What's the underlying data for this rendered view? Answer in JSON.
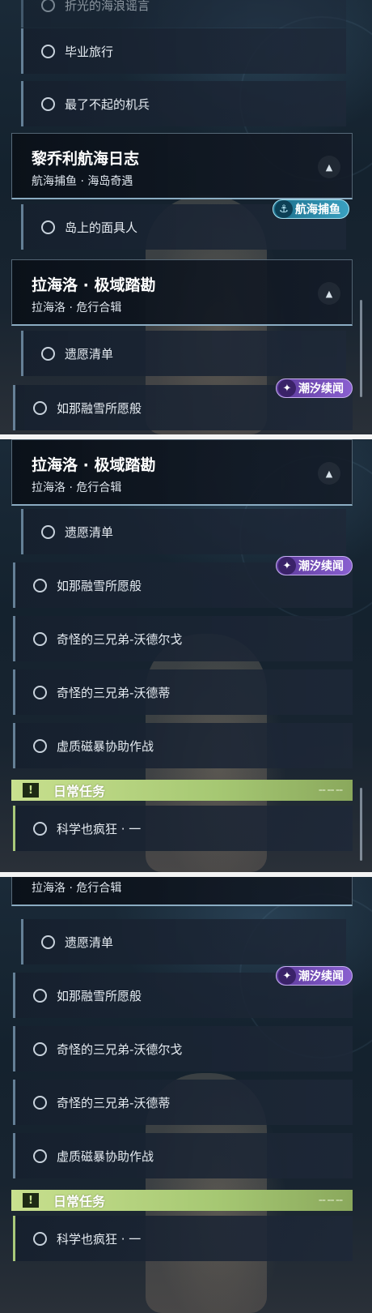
{
  "panel1": {
    "cut_item": "折光的海浪谣言",
    "items_top": [
      "毕业旅行",
      "最了不起的机兵"
    ],
    "header1": {
      "title": "黎乔利航海日志",
      "subtitle": "航海捕鱼 · 海岛奇遇"
    },
    "badge_fishing": "航海捕鱼",
    "item_mask": "岛上的面具人",
    "header2": {
      "title": "拉海洛 · 极域踏勘",
      "subtitle": "拉海洛 · 危行合辑"
    },
    "item_wish": "遗愿清单",
    "badge_tide": "潮汐续闻",
    "item_snow": "如那融雪所愿般"
  },
  "panel2": {
    "header": {
      "title": "拉海洛 · 极域踏勘",
      "subtitle": "拉海洛 · 危行合辑"
    },
    "items": [
      "遗愿清单",
      "如那融雪所愿般",
      "奇怪的三兄弟-沃德尔戈",
      "奇怪的三兄弟-沃德蒂",
      "虚质磁暴协助作战"
    ],
    "badge_tide": "潮汐续闻",
    "daily_title": "日常任务",
    "daily_item": "科学也疯狂 · 一"
  },
  "panel3": {
    "header_subtitle": "拉海洛 · 危行合辑",
    "items": [
      "遗愿清单",
      "如那融雪所愿般",
      "奇怪的三兄弟-沃德尔戈",
      "奇怪的三兄弟-沃德蒂",
      "虚质磁暴协助作战"
    ],
    "badge_tide": "潮汐续闻",
    "daily_title": "日常任务",
    "daily_item": "科学也疯狂 · 一"
  },
  "icons": {
    "collapse": "chevron-up-icon",
    "radio": "circle-icon",
    "daily": "exclamation-icon",
    "tide": "tide-icon",
    "fishing": "fishing-icon"
  },
  "colors": {
    "accent_green": "#a9c97a",
    "badge_purple": "#7a50c0",
    "badge_teal": "#2e8cb0"
  }
}
